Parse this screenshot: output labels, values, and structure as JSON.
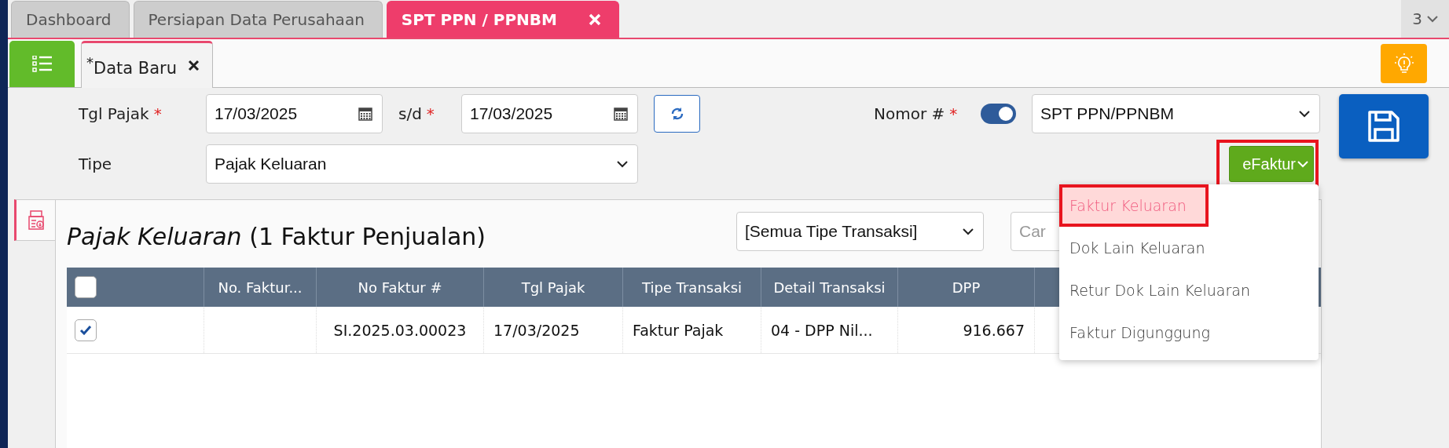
{
  "tabs": [
    {
      "label": "Dashboard",
      "selected": false
    },
    {
      "label": "Persiapan Data Perusahaan",
      "selected": false
    },
    {
      "label": "SPT PPN / PPNBM",
      "selected": true
    }
  ],
  "tab_count": "3",
  "subtabs": [
    {
      "label": "$^{*}$Data Baru",
      "selected": true
    }
  ],
  "form": {
    "tgl_pajak": {
      "label": "Tgl Pajak",
      "mark": "*",
      "value": "17/03/2025"
    },
    "sd": {
      "label": "s/d",
      "mark": "*",
      "value": "17/03/2025"
    },
    "tipe": {
      "label": "Tipe",
      "value": "Pajak Keluaran"
    },
    "nomor": {
      "label": "Nomor #",
      "mark": "*",
      "on": true,
      "value": "SPT PPN/PPNBM"
    }
  },
  "efaktur": {
    "label": "eFaktur",
    "annotated": true,
    "expanded": true,
    "menu": [
      {
        "label": "Faktur Keluaran",
        "selected": true,
        "annotated": true
      },
      {
        "label": "Dok Lain Keluaran",
        "selected": false,
        "annotated": false
      },
      {
        "label": "Retur Dok Lain Keluaran",
        "selected": false,
        "annotated": false
      },
      {
        "label": "Faktur Digunggung",
        "selected": false,
        "annotated": false
      }
    ]
  },
  "panel": {
    "title": "*Pajak Keluaran* (1 Faktur Penjualan)",
    "filter": "[Semua Tipe Transaksi]",
    "search_placeholder": "Car"
  },
  "table": {
    "all_checked": false,
    "columns": [
      "No. Faktur...",
      "No Faktur #",
      "Tgl Pajak",
      "Tipe Transaksi",
      "Detail Transaksi",
      "DPP"
    ],
    "rows": [
      {
        "checked": true,
        "cells": [
          null,
          "SI.2025.03.00023",
          "17/03/2025",
          "Faktur Pajak",
          "04 - DPP Nil...",
          "916.667"
        ]
      }
    ]
  }
}
